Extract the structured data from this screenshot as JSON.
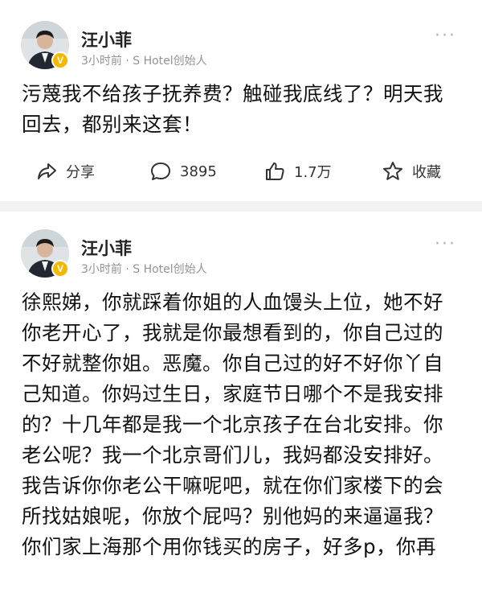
{
  "posts": [
    {
      "author": "汪小菲",
      "meta": "3小时前 · S Hotel创始人",
      "verified_badge": "V",
      "more_label": "···",
      "content": "污蔑我不给孩子抚养费？触碰我底线了？明天我回去，都别来这套！",
      "actions": {
        "share_label": "分享",
        "comment_count": "3895",
        "like_count": "1.7万",
        "favorite_label": "收藏"
      }
    },
    {
      "author": "汪小菲",
      "meta": "3小时前 · S Hotel创始人",
      "verified_badge": "V",
      "more_label": "···",
      "content": "徐熙娣，你就踩着你姐的人血馒头上位，她不好你老开心了，我就是你最想看到的，你自己过的不好就整你姐。恶魔。你自己过的好不好你丫自己知道。你妈过生日，家庭节日哪个不是我安排的？十几年都是我一个北京孩子在台北安排。你老公呢？我一个北京哥们儿，我妈都没安排好。我告诉你你老公干嘛呢吧，就在你们家楼下的会所找姑娘呢，你放个屁吗？别他妈的来逼逼我？你们家上海那个用你钱买的房子，好多p，你再"
    }
  ],
  "colors": {
    "background": "#f2f2f2",
    "card": "#ffffff",
    "meta_text": "#939393",
    "verified_badge": "#f5b800"
  },
  "icons": [
    "share-icon",
    "comment-icon",
    "like-icon",
    "star-icon",
    "more-icon",
    "verified-badge"
  ]
}
